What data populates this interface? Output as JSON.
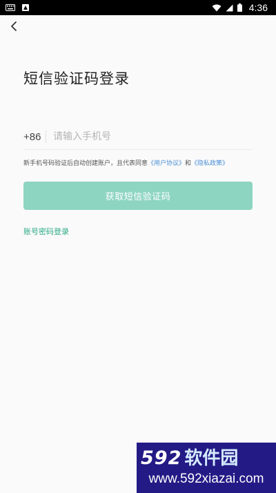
{
  "status_bar": {
    "time": "4:36",
    "icons": [
      "keyboard-icon",
      "app-notification-icon",
      "wifi-icon",
      "signal-icon",
      "battery-icon"
    ]
  },
  "page": {
    "title": "短信验证码登录"
  },
  "phone": {
    "country_code": "+86",
    "placeholder": "请输入手机号"
  },
  "agreement": {
    "prefix": "新手机号码验证后自动创建账户，且代表同意",
    "user_agreement": "《用户协议》",
    "conjunction": "和",
    "privacy_policy": "《隐私政策》"
  },
  "actions": {
    "get_code_label": "获取短信验证码",
    "password_login_label": "账号密码登录"
  },
  "watermark": {
    "number": "592",
    "name": "软件园",
    "url": "www.592xiazai.com"
  },
  "colors": {
    "accent": "#2daa86",
    "button_disabled": "#8ed5c1",
    "link": "#4a8fd6",
    "status_bar": "#000000",
    "watermark_bg": "#241a86"
  }
}
